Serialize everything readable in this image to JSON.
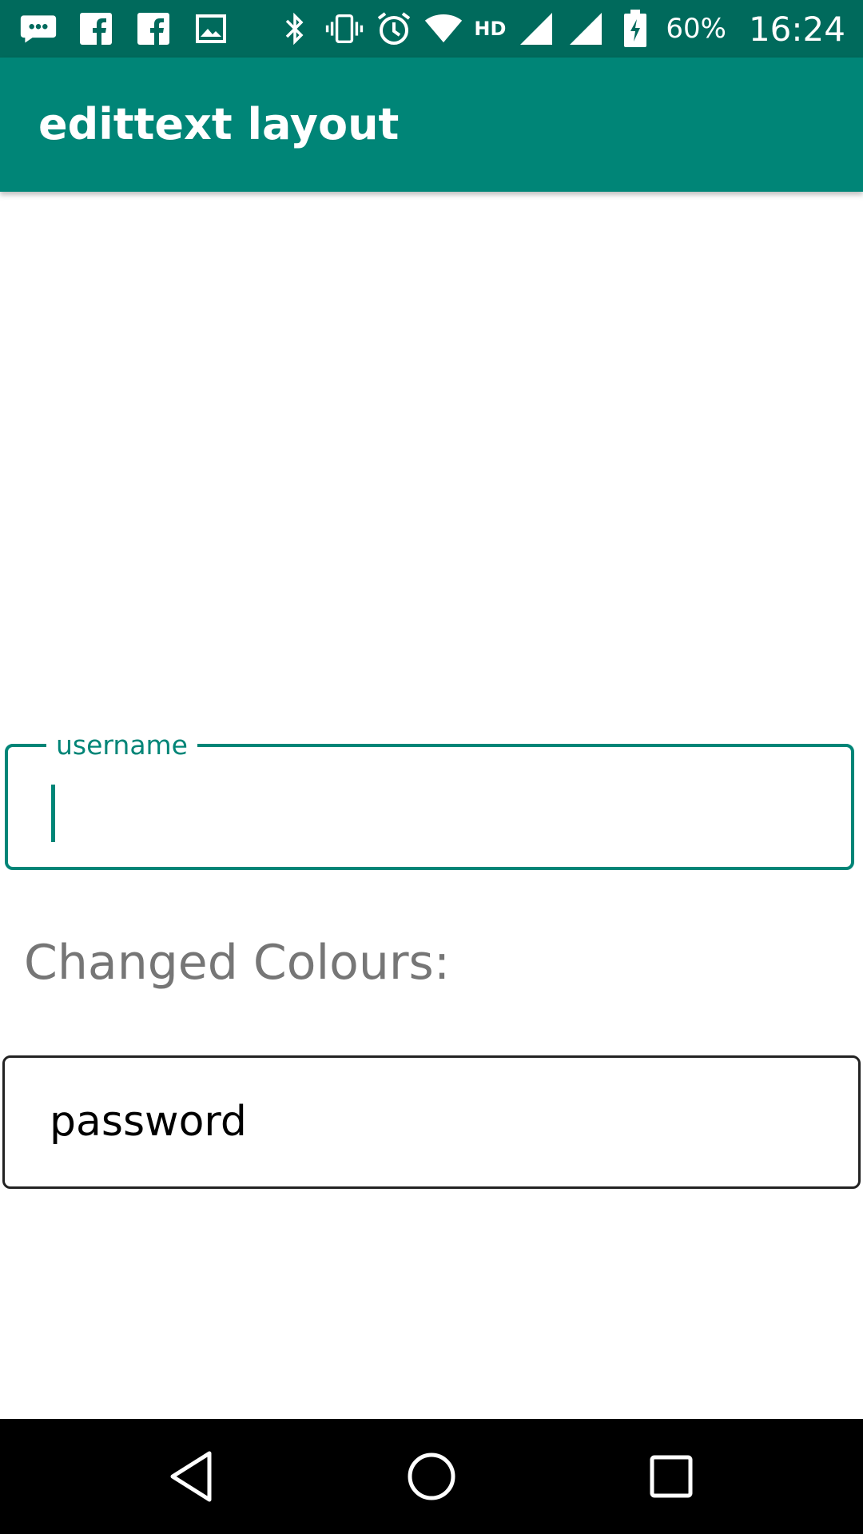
{
  "status_bar": {
    "battery_percent": "60%",
    "network_type": "HD",
    "time": "16:24",
    "icons_left": [
      "messenger-icon",
      "facebook-icon",
      "facebook-icon",
      "image-icon"
    ],
    "icons_right": [
      "bluetooth-icon",
      "vibrate-icon",
      "alarm-icon",
      "wifi-icon",
      "signal-icon",
      "signal-icon",
      "battery-charging-icon"
    ]
  },
  "app_bar": {
    "title": "edittext layout"
  },
  "form": {
    "username": {
      "label": "username",
      "value": ""
    },
    "section_heading": "Changed Colours:",
    "password": {
      "value": "password"
    }
  },
  "nav_bar": {
    "buttons": [
      "back-icon",
      "home-icon",
      "recents-icon"
    ]
  },
  "colors": {
    "primary": "#008577",
    "primary_dark": "#006a5c",
    "heading_gray": "#767676"
  }
}
